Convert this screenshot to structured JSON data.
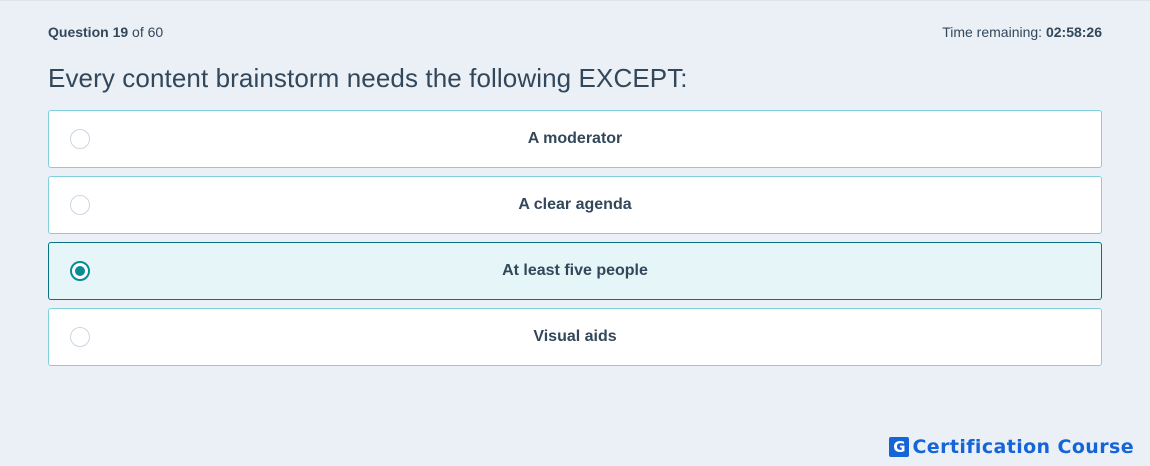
{
  "header": {
    "question_word": "Question",
    "question_number": "19",
    "question_of": "of",
    "question_total": "60",
    "time_label": "Time remaining:",
    "time_value": "02:58:26"
  },
  "question": {
    "text": "Every content brainstorm needs the following EXCEPT:"
  },
  "options": [
    {
      "label": "A moderator",
      "selected": false
    },
    {
      "label": "A clear agenda",
      "selected": false
    },
    {
      "label": "At least five people",
      "selected": true
    },
    {
      "label": "Visual aids",
      "selected": false
    }
  ],
  "brand": {
    "icon_letter": "G",
    "text": "Certification Course",
    "color": "#1565d8"
  },
  "colors": {
    "background": "#eaf0f6",
    "option_border": "#7fd1de",
    "selected_fill": "#e5f5f8",
    "selected_accent": "#0b8a98",
    "text": "#33475b"
  }
}
